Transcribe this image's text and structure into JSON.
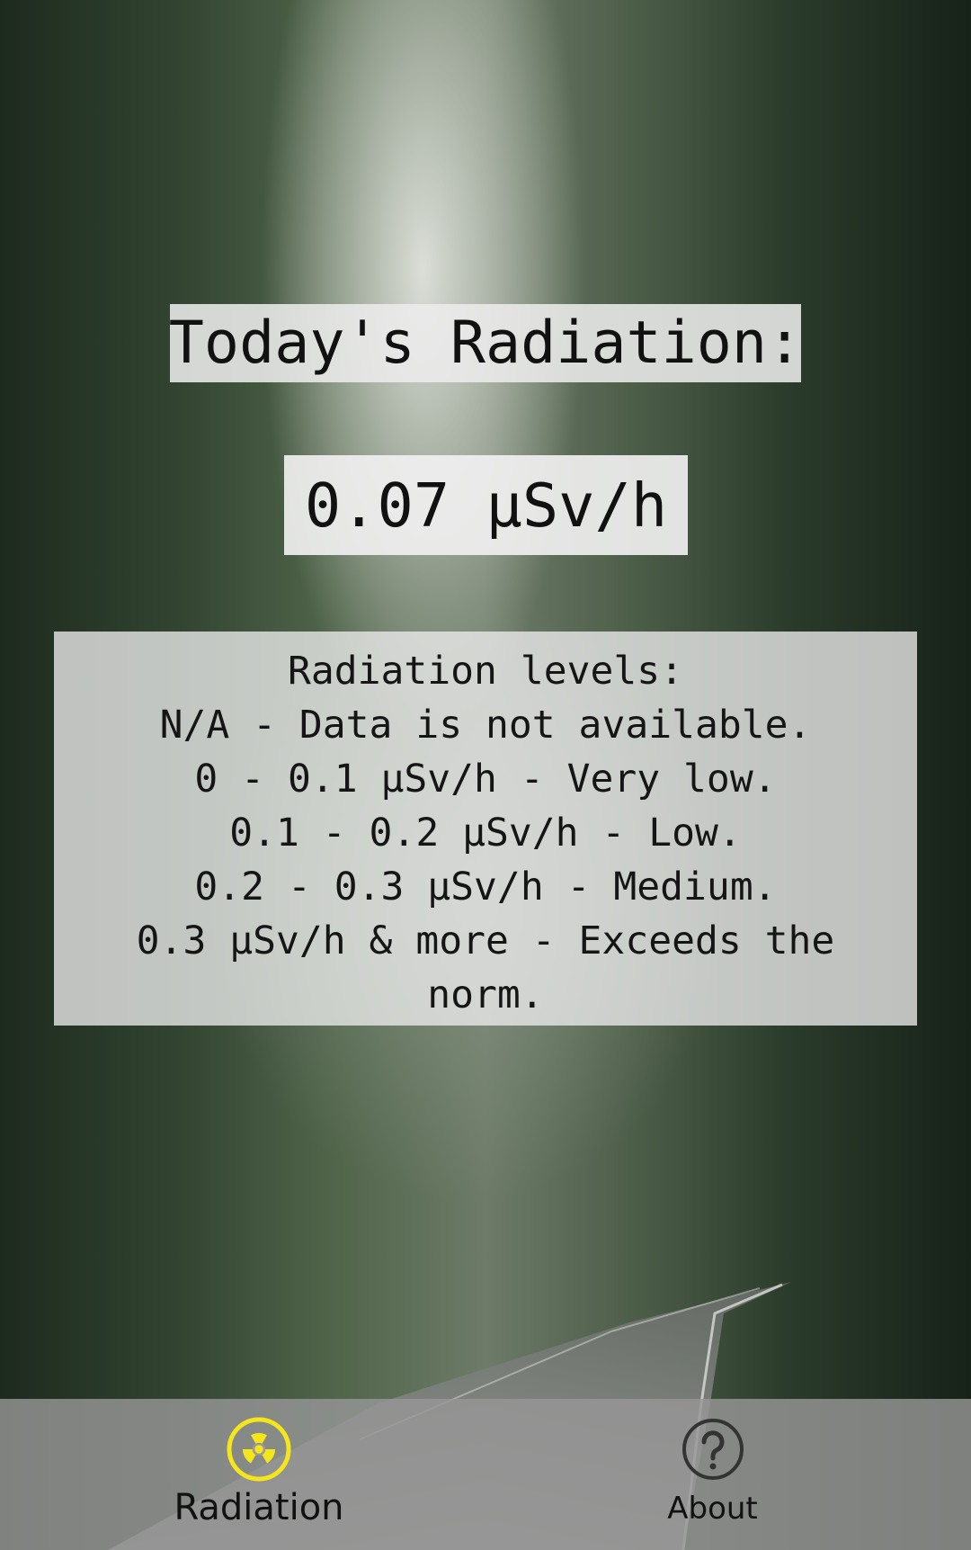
{
  "header": {
    "title": "Today's Radiation:"
  },
  "reading": {
    "value": "0.07 µSv/h"
  },
  "levels": {
    "heading": "Radiation levels:",
    "items": [
      "N/A - Data is not available.",
      "0 - 0.1 µSv/h - Very low.",
      "0.1 - 0.2 µSv/h - Low.",
      "0.2 - 0.3 µSv/h - Medium.",
      "0.3 µSv/h & more - Exceeds the norm."
    ]
  },
  "bottom_nav": {
    "items": [
      {
        "label": "Radiation",
        "icon": "radiation-icon",
        "active": true,
        "icon_color": "#f5e51b"
      },
      {
        "label": "About",
        "icon": "help-circle-icon",
        "active": false,
        "icon_color": "#333333"
      }
    ]
  }
}
